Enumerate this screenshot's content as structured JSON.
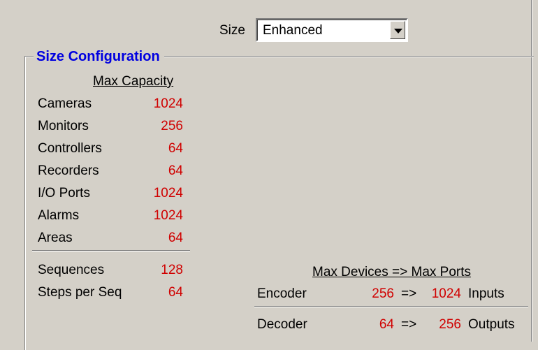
{
  "size": {
    "label": "Size",
    "value": "Enhanced"
  },
  "group": {
    "title": "Size Configuration"
  },
  "capacity": {
    "header": "Max Capacity",
    "rows": [
      {
        "label": "Cameras",
        "value": "1024"
      },
      {
        "label": "Monitors",
        "value": "256"
      },
      {
        "label": "Controllers",
        "value": "64"
      },
      {
        "label": "Recorders",
        "value": "64"
      },
      {
        "label": "I/O Ports",
        "value": "1024"
      },
      {
        "label": "Alarms",
        "value": "1024"
      },
      {
        "label": "Areas",
        "value": "64"
      }
    ]
  },
  "sequences": [
    {
      "label": "Sequences",
      "value": "128"
    },
    {
      "label": "Steps per Seq",
      "value": "64"
    }
  ],
  "devices": {
    "header": "Max Devices => Max Ports",
    "arrow": "=>",
    "rows": [
      {
        "label": "Encoder",
        "devices": "256",
        "ports": "1024",
        "type": "Inputs"
      },
      {
        "label": "Decoder",
        "devices": "64",
        "ports": "256",
        "type": "Outputs"
      }
    ]
  },
  "colors": {
    "value_red": "#d00000",
    "title_blue": "#0000e0",
    "background": "#d4d0c8"
  }
}
